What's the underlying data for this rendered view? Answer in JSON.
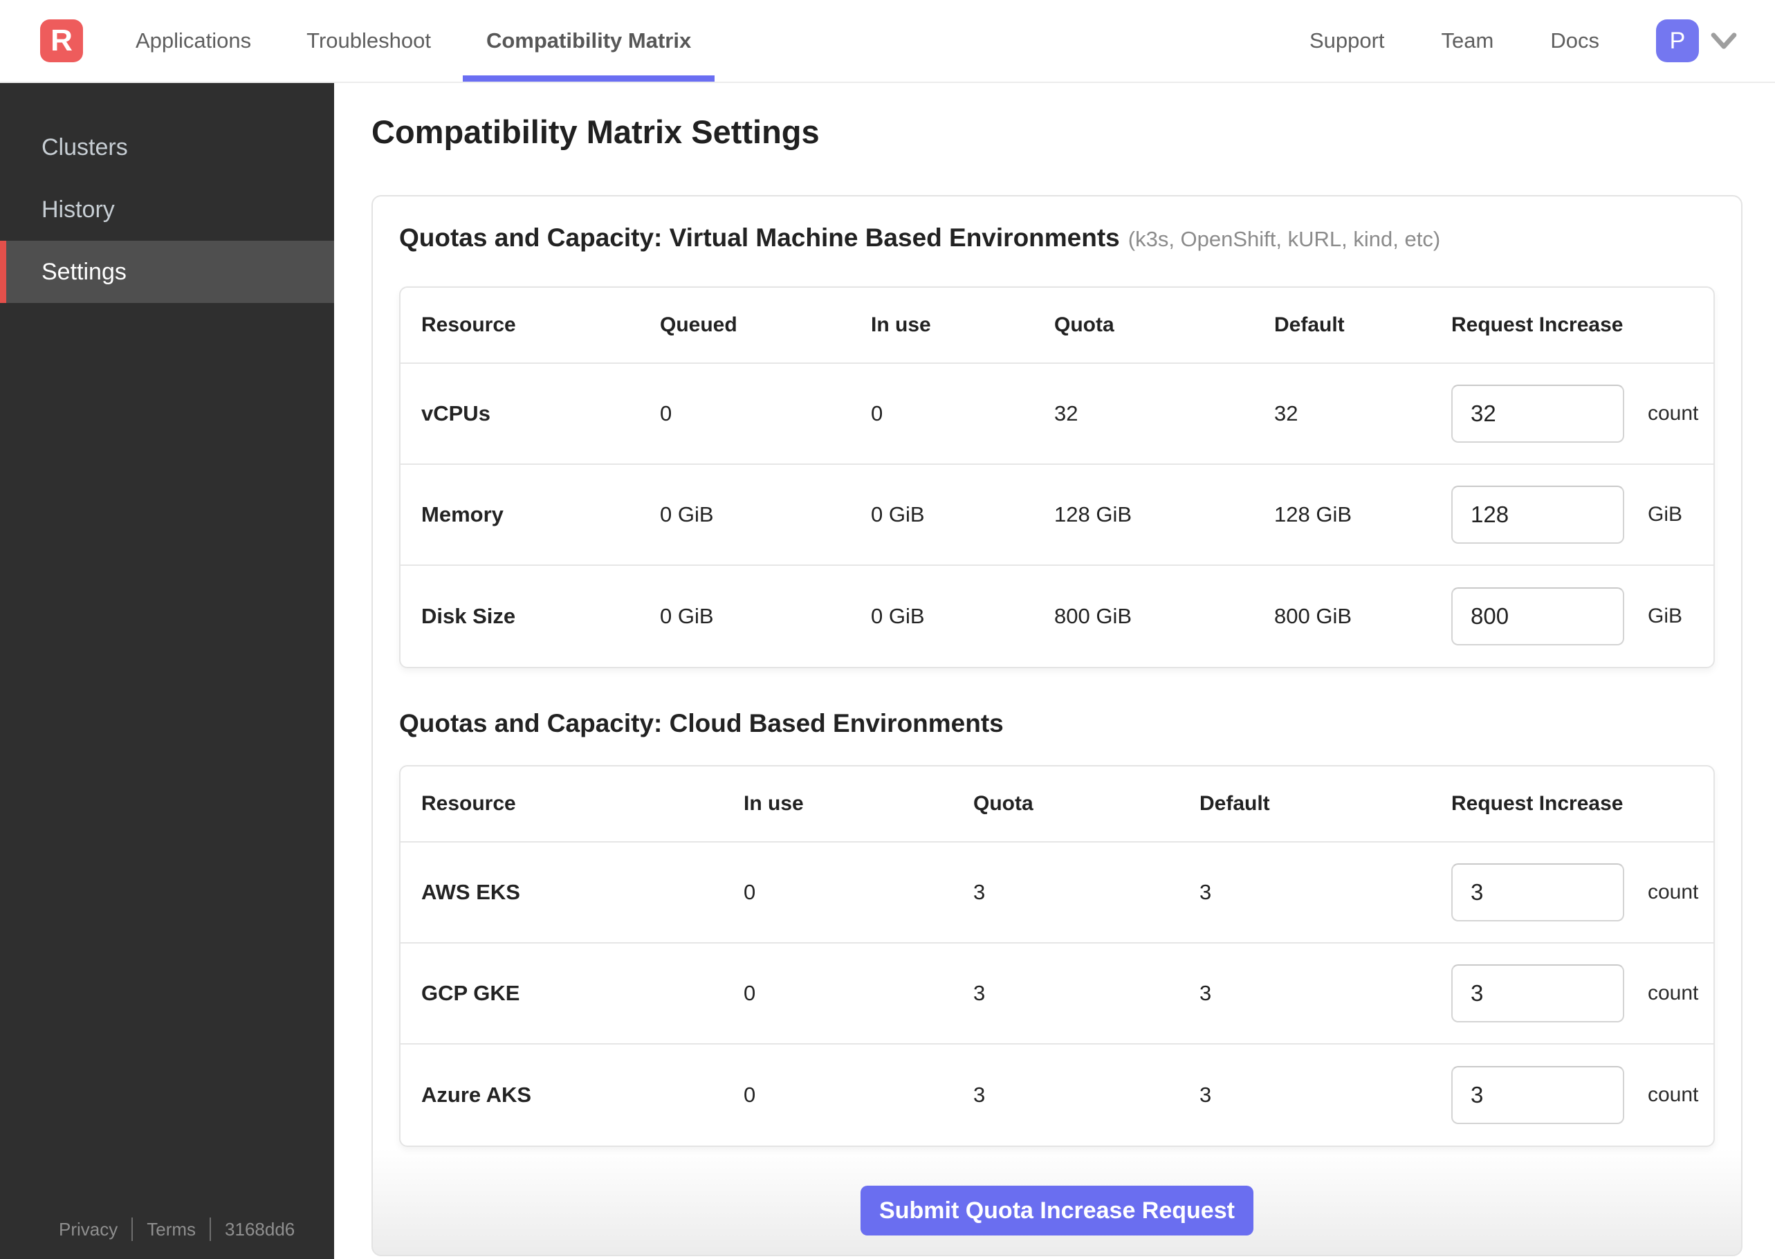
{
  "header": {
    "logo_letter": "R",
    "nav": [
      {
        "label": "Applications"
      },
      {
        "label": "Troubleshoot"
      },
      {
        "label": "Compatibility Matrix",
        "active": true
      }
    ],
    "links": {
      "support": "Support",
      "team": "Team",
      "docs": "Docs"
    },
    "avatar_letter": "P"
  },
  "sidebar": {
    "items": [
      {
        "label": "Clusters"
      },
      {
        "label": "History"
      },
      {
        "label": "Settings",
        "active": true
      }
    ],
    "footer": {
      "privacy": "Privacy",
      "terms": "Terms",
      "build": "3168dd6"
    }
  },
  "page": {
    "title": "Compatibility Matrix Settings"
  },
  "vm_section": {
    "title": "Quotas and Capacity: Virtual Machine Based Environments",
    "subtitle": "(k3s, OpenShift, kURL, kind, etc)",
    "headers": [
      "Resource",
      "Queued",
      "In use",
      "Quota",
      "Default",
      "Request Increase"
    ],
    "rows": [
      {
        "resource": "vCPUs",
        "queued": "0",
        "in_use": "0",
        "quota": "32",
        "default": "32",
        "input": "32",
        "unit": "count"
      },
      {
        "resource": "Memory",
        "queued": "0 GiB",
        "in_use": "0 GiB",
        "quota": "128 GiB",
        "default": "128 GiB",
        "input": "128",
        "unit": "GiB"
      },
      {
        "resource": "Disk Size",
        "queued": "0 GiB",
        "in_use": "0 GiB",
        "quota": "800 GiB",
        "default": "800 GiB",
        "input": "800",
        "unit": "GiB"
      }
    ]
  },
  "cloud_section": {
    "title": "Quotas and Capacity: Cloud Based Environments",
    "headers": [
      "Resource",
      "In use",
      "Quota",
      "Default",
      "Request Increase"
    ],
    "rows": [
      {
        "resource": "AWS EKS",
        "in_use": "0",
        "quota": "3",
        "default": "3",
        "input": "3",
        "unit": "count"
      },
      {
        "resource": "GCP GKE",
        "in_use": "0",
        "quota": "3",
        "default": "3",
        "input": "3",
        "unit": "count"
      },
      {
        "resource": "Azure AKS",
        "in_use": "0",
        "quota": "3",
        "default": "3",
        "input": "3",
        "unit": "count"
      }
    ]
  },
  "actions": {
    "submit_label": "Submit Quota Increase Request"
  },
  "colors": {
    "accent_purple": "#6a6ef0",
    "brand_red": "#ee5c5c",
    "sidebar_active_red": "#e4504b",
    "sidebar_bg": "#2f2f2f",
    "sidebar_active_bg": "#4f4f4f"
  }
}
